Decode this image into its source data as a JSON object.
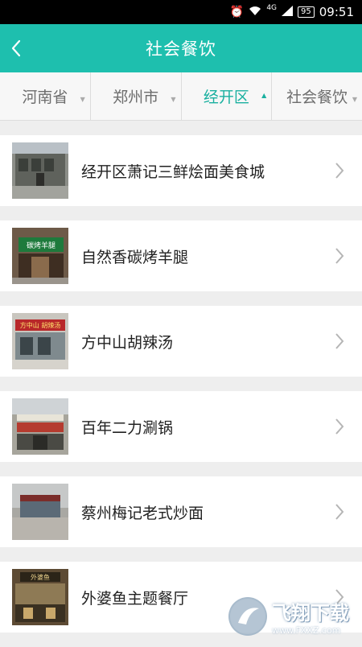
{
  "status_bar": {
    "network": "4G",
    "battery": "95",
    "time": "09:51",
    "icons": [
      "alarm-icon",
      "wifi-icon",
      "signal-icon",
      "battery-icon"
    ]
  },
  "header": {
    "title": "社会餐饮",
    "back_icon": "back-chevron-icon"
  },
  "filters": [
    {
      "label": "河南省",
      "active": false
    },
    {
      "label": "郑州市",
      "active": false
    },
    {
      "label": "经开区",
      "active": true
    },
    {
      "label": "社会餐饮",
      "active": false
    }
  ],
  "restaurants": [
    {
      "name": "经开区萧记三鲜烩面美食城"
    },
    {
      "name": "自然香碳烤羊腿",
      "sign": "碳烤羊腿"
    },
    {
      "name": "方中山胡辣汤",
      "sign": "方中山 胡辣汤"
    },
    {
      "name": "百年二力涮锅"
    },
    {
      "name": "蔡州梅记老式炒面"
    },
    {
      "name": "外婆鱼主题餐厅",
      "sign": "外婆鱼"
    }
  ],
  "watermark": {
    "text": "飞翔下载",
    "url": "www.FXXZ.com"
  },
  "colors": {
    "accent": "#1ebfae",
    "active_filter": "#1ab0a0",
    "background": "#eeeeee"
  }
}
